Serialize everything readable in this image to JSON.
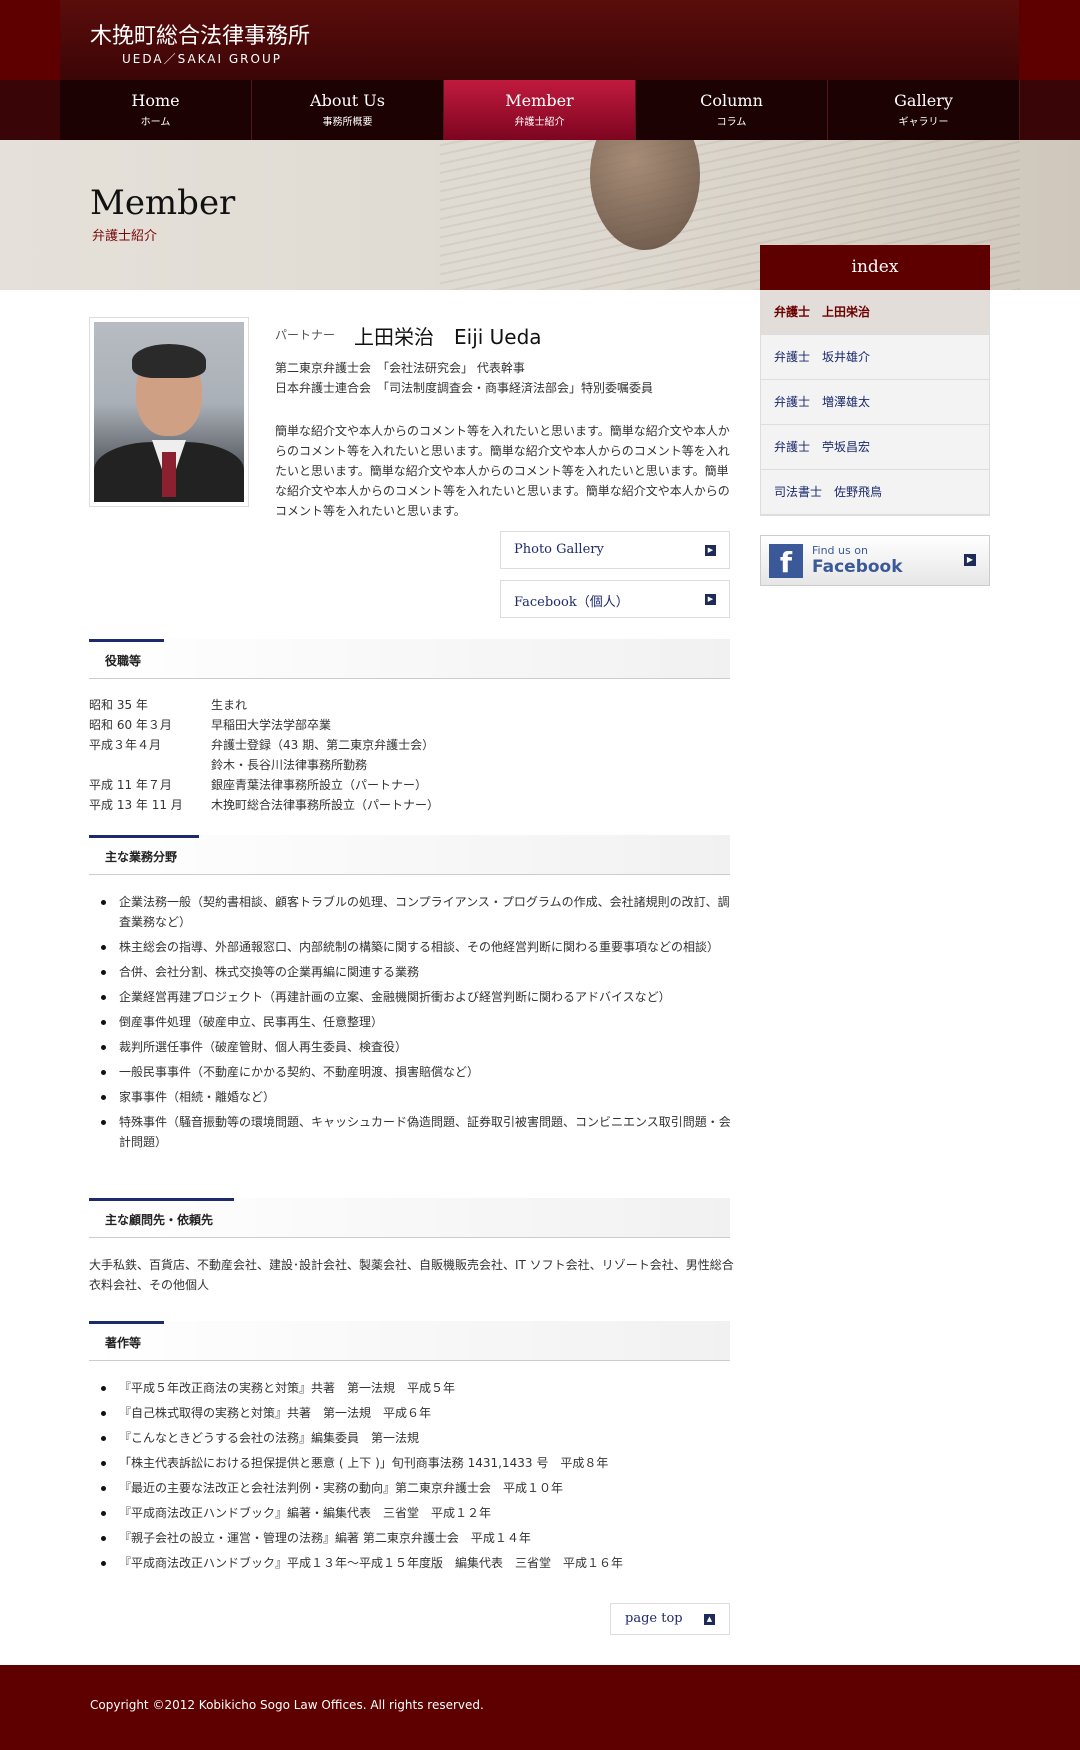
{
  "header": {
    "logo_jp": "木挽町総合法律事務所",
    "logo_en": "UEDA／SAKAI GROUP"
  },
  "nav": [
    {
      "en": "Home",
      "jp": "ホーム"
    },
    {
      "en": "About Us",
      "jp": "事務所概要"
    },
    {
      "en": "Member",
      "jp": "弁護士紹介",
      "active": true
    },
    {
      "en": "Column",
      "jp": "コラム"
    },
    {
      "en": "Gallery",
      "jp": "ギャラリー"
    }
  ],
  "hero": {
    "title": "Member",
    "subtitle": "弁護士紹介"
  },
  "index": {
    "title": "index",
    "items": [
      "弁護士　上田栄治",
      "弁護士　坂井雄介",
      "弁護士　増澤雄太",
      "弁護士　苧坂昌宏",
      "司法書士　佐野飛鳥"
    ]
  },
  "facebook": {
    "find": "Find us on",
    "name": "Facebook",
    "logo": "f"
  },
  "profile": {
    "role": "パートナー",
    "name": "上田栄治　Eiji Ueda",
    "titles": [
      "第二東京弁護士会　「会社法研究会」 代表幹事",
      "日本弁護士連合会　「司法制度調査会・商事経済法部会」特別委嘱委員"
    ],
    "intro": "簡単な紹介文や本人からのコメント等を入れたいと思います。簡単な紹介文や本人からのコメント等を入れたいと思います。簡単な紹介文や本人からのコメント等を入れたいと思います。簡単な紹介文や本人からのコメント等を入れたいと思います。簡単な紹介文や本人からのコメント等を入れたいと思います。簡単な紹介文や本人からのコメント等を入れたいと思います。"
  },
  "buttons": {
    "photo_gallery": "Photo Gallery",
    "facebook_personal": "Facebook（個人）"
  },
  "sections": {
    "career": "役職等",
    "fields": "主な業務分野",
    "clients": "主な顧問先・依頼先",
    "works": "著作等"
  },
  "career": [
    {
      "date": "昭和 35 年",
      "text": "生まれ"
    },
    {
      "date": "昭和 60 年３月",
      "text": "早稲田大学法学部卒業"
    },
    {
      "date": "平成３年４月",
      "text": "弁護士登録（43 期、第二東京弁護士会）"
    },
    {
      "date": "",
      "text": "鈴木・長谷川法律事務所勤務"
    },
    {
      "date": "平成 11 年７月",
      "text": "銀座青葉法律事務所設立（パートナー）"
    },
    {
      "date": "平成 13 年 11 月",
      "text": "木挽町総合法律事務所設立（パートナー）"
    }
  ],
  "fields": [
    "企業法務一般（契約書相談、顧客トラブルの処理、コンプライアンス・プログラムの作成、会社諸規則の改訂、調査業務など）",
    "株主総会の指導、外部通報窓口、内部統制の構築に関する相談、その他経営判断に関わる重要事項などの相談）",
    "合併、会社分割、株式交換等の企業再編に関連する業務",
    "企業経営再建プロジェクト（再建計画の立案、金融機関折衝および経営判断に関わるアドバイスなど）",
    "倒産事件処理（破産申立、民事再生、任意整理）",
    "裁判所選任事件（破産管財、個人再生委員、検査役）",
    "一般民事事件（不動産にかかる契約、不動産明渡、損害賠償など）",
    "家事事件（相続・離婚など）",
    "特殊事件（騒音振動等の環境問題、キャッシュカード偽造問題、証券取引被害問題、コンビニエンス取引問題・会計問題）"
  ],
  "clients": "大手私鉄、百貨店、不動産会社、建設･設計会社、製薬会社、自販機販売会社、IT ソフト会社、リゾート会社、男性総合衣料会社、その他個人",
  "works": [
    "『平成５年改正商法の実務と対策』共著　第一法規　平成５年",
    "『自己株式取得の実務と対策』共著　第一法規　平成６年",
    "『こんなときどうする会社の法務』編集委員　第一法規",
    "「株主代表訴訟における担保提供と悪意 ( 上下 )」旬刊商事法務 1431,1433 号　平成８年",
    "『最近の主要な法改正と会社法判例・実務の動向』第二東京弁護士会　平成１０年",
    "『平成商法改正ハンドブック』編著・編集代表　三省堂　平成１２年",
    "『親子会社の設立・運営・管理の法務』編著 第二東京弁護士会　平成１４年",
    "『平成商法改正ハンドブック』平成１３年〜平成１５年度版　編集代表　三省堂　平成１６年"
  ],
  "pagetop": "page top",
  "footer": "Copyright ©2012 Kobikicho Sogo Law Offices. All rights reserved.",
  "colors": {
    "brand": "#5e0000",
    "accent": "#1d2a6b",
    "nav_active": "#c11a3e"
  }
}
